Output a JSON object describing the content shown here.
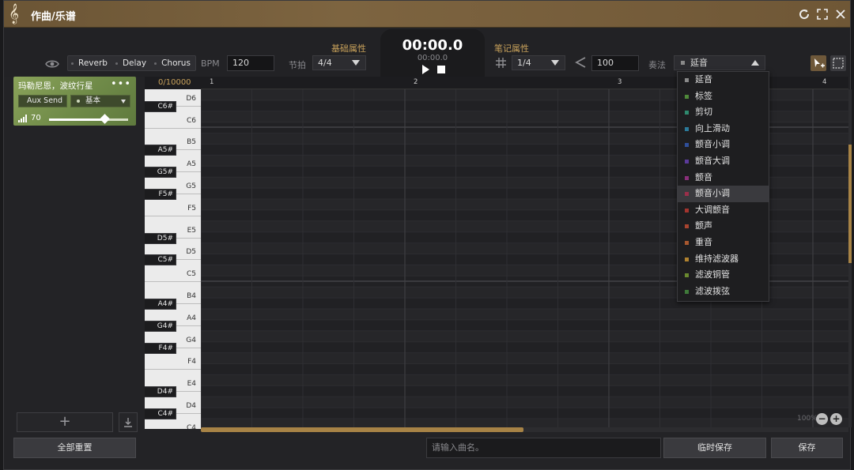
{
  "window": {
    "title": "作曲/乐谱"
  },
  "icons": {
    "title": "treble-clef-icon",
    "refresh": "refresh-icon",
    "fullscreen": "fullscreen-icon",
    "close": "close-icon",
    "eye": "eye-icon",
    "grid": "grid-icon",
    "arrow_left": "arrow-left-icon",
    "select_tool": "select-cursor-icon",
    "marquee_tool": "marquee-icon",
    "import": "import-icon",
    "volume": "volume-icon"
  },
  "effects": [
    "Reverb",
    "Delay",
    "Chorus"
  ],
  "basic": {
    "header": "基础属性",
    "bpm_label": "BPM",
    "bpm_value": "120",
    "meter_label": "节拍",
    "meter_value": "4/4"
  },
  "transport": {
    "time": "00:00.0",
    "subtime": "00:00.0"
  },
  "note": {
    "header": "笔记属性",
    "grid_value": "1/4",
    "velocity_value": "100",
    "technique_label": "奏法",
    "technique_value": "延音"
  },
  "track": {
    "name": "玛勒尼恩，波纹行星",
    "more": "•••",
    "aux_send": "Aux Send",
    "preset": "基本",
    "volume": 70
  },
  "piano_header": "0/10000",
  "ruler": [
    "1",
    "2",
    "3",
    "4"
  ],
  "piano_keys": {
    "white": [
      "D6",
      "C6",
      "B5",
      "A5",
      "G5",
      "F5",
      "E5",
      "D5",
      "C5",
      "B4",
      "A4",
      "G4",
      "F4",
      "E4",
      "D4",
      "C4"
    ],
    "black": [
      "C6#",
      "A5#",
      "G5#",
      "F5#",
      "D5#",
      "C5#",
      "A4#",
      "G4#",
      "F4#",
      "D4#",
      "C4#"
    ]
  },
  "dropdown": {
    "selected_index": 7,
    "items": [
      {
        "label": "延音",
        "color": "#8a8a8a"
      },
      {
        "label": "标签",
        "color": "#4f8a3a"
      },
      {
        "label": "剪切",
        "color": "#2e8a6e"
      },
      {
        "label": "向上滑动",
        "color": "#2b7a9a"
      },
      {
        "label": "颤音小调",
        "color": "#2f4f9a"
      },
      {
        "label": "颤音大调",
        "color": "#5b3a9a"
      },
      {
        "label": "颤音",
        "color": "#8a2f7a"
      },
      {
        "label": "颤音小调",
        "color": "#9a2f4a"
      },
      {
        "label": "大调颤音",
        "color": "#a3342e"
      },
      {
        "label": "颤声",
        "color": "#a8442f"
      },
      {
        "label": "重音",
        "color": "#a8582f"
      },
      {
        "label": "维持滤波器",
        "color": "#b0822f"
      },
      {
        "label": "滤波铜管",
        "color": "#6a8a2f"
      },
      {
        "label": "滤波拨弦",
        "color": "#3f7a3a"
      }
    ]
  },
  "zoom": {
    "text": "100%",
    "minus": "−",
    "plus": "+"
  },
  "footer": {
    "reset_all": "全部重置",
    "name_placeholder": "请输入曲名。",
    "temp_save": "临时保存",
    "save": "保存",
    "add": "+"
  }
}
